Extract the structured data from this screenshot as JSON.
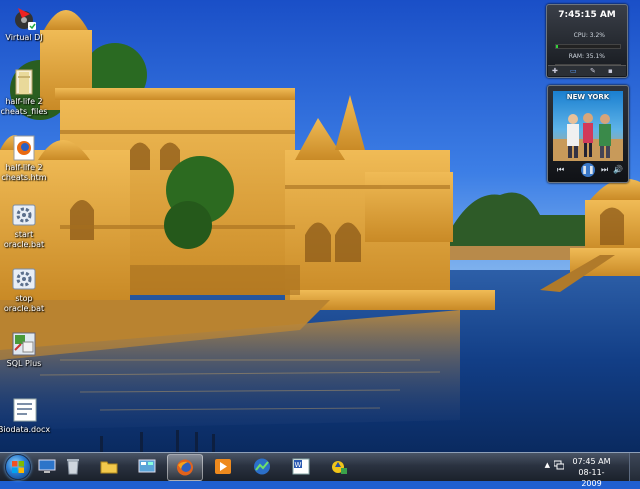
{
  "desktop": {
    "icons": [
      {
        "label": "Virtual DJ",
        "icon": "virtual-dj-icon"
      },
      {
        "label": "half-life 2 cheats_files",
        "icon": "folder-icon"
      },
      {
        "label": "half-life 2 cheats.htm",
        "icon": "firefox-document-icon"
      },
      {
        "label": "start oracle.bat",
        "icon": "batch-file-icon"
      },
      {
        "label": "stop oracle.bat",
        "icon": "batch-file-icon"
      },
      {
        "label": "SQL Plus",
        "icon": "sql-plus-icon"
      },
      {
        "label": "Biodata.docx",
        "icon": "word-document-icon"
      }
    ]
  },
  "gadgets": {
    "clock": {
      "time": "7:45:15 AM",
      "cpu_label": "CPU: 3.2%",
      "cpu_percent": 3.2,
      "ram_label": "RAM: 35.1%",
      "ram_percent": 35.1
    },
    "media": {
      "album_title": "NEW YORK"
    }
  },
  "taskbar": {
    "pinned": [
      {
        "name": "windows-explorer",
        "icon": "computer-icon"
      },
      {
        "name": "recycle-bin",
        "icon": "recycle-bin-icon"
      },
      {
        "name": "file-explorer",
        "icon": "folder-icon"
      },
      {
        "name": "control-panel",
        "icon": "control-panel-icon"
      },
      {
        "name": "firefox",
        "icon": "firefox-icon",
        "active": true
      },
      {
        "name": "media-player",
        "icon": "media-player-icon"
      },
      {
        "name": "stocks",
        "icon": "chart-icon"
      },
      {
        "name": "word",
        "icon": "word-icon"
      },
      {
        "name": "app",
        "icon": "generic-app-icon"
      }
    ],
    "clock": {
      "time": "07:45 AM",
      "date": "08-11-2009"
    }
  },
  "colors": {
    "sky": "#1f5fd0",
    "water": "#0e3d82",
    "sandstone": "#d9a23b",
    "taskbar": "#2a3240"
  }
}
